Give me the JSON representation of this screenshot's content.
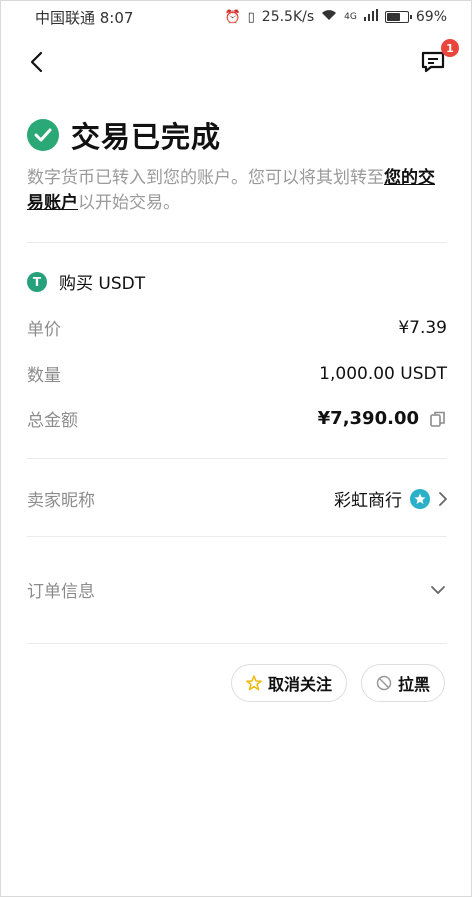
{
  "status_bar": {
    "carrier_time": "中国联通 8:07",
    "net_speed": "25.5K/s",
    "network": "4G",
    "battery_percent": "69%",
    "battery_level": 0.69
  },
  "nav": {
    "unread_count": "1"
  },
  "header": {
    "title": "交易已完成",
    "desc_prefix": "数字货币已转入到您的账户。您可以将其划转至",
    "desc_link": "您的交易账户",
    "desc_suffix": "以开始交易。"
  },
  "asset": {
    "icon_letter": "T",
    "title": "购买 USDT"
  },
  "details": {
    "price_label": "单价",
    "price_value": "¥7.39",
    "quantity_label": "数量",
    "quantity_value": "1,000.00 USDT",
    "total_label": "总金额",
    "total_value": "¥7,390.00"
  },
  "seller": {
    "label": "卖家昵称",
    "name": "彩虹商行"
  },
  "order": {
    "label": "订单信息"
  },
  "actions": {
    "unfollow_label": "取消关注",
    "block_label": "拉黑"
  },
  "colors": {
    "success": "#2aa876",
    "tether": "#26a17b",
    "badge": "#e8453c",
    "verified": "#2ab1c9",
    "star": "#f0b90b"
  }
}
